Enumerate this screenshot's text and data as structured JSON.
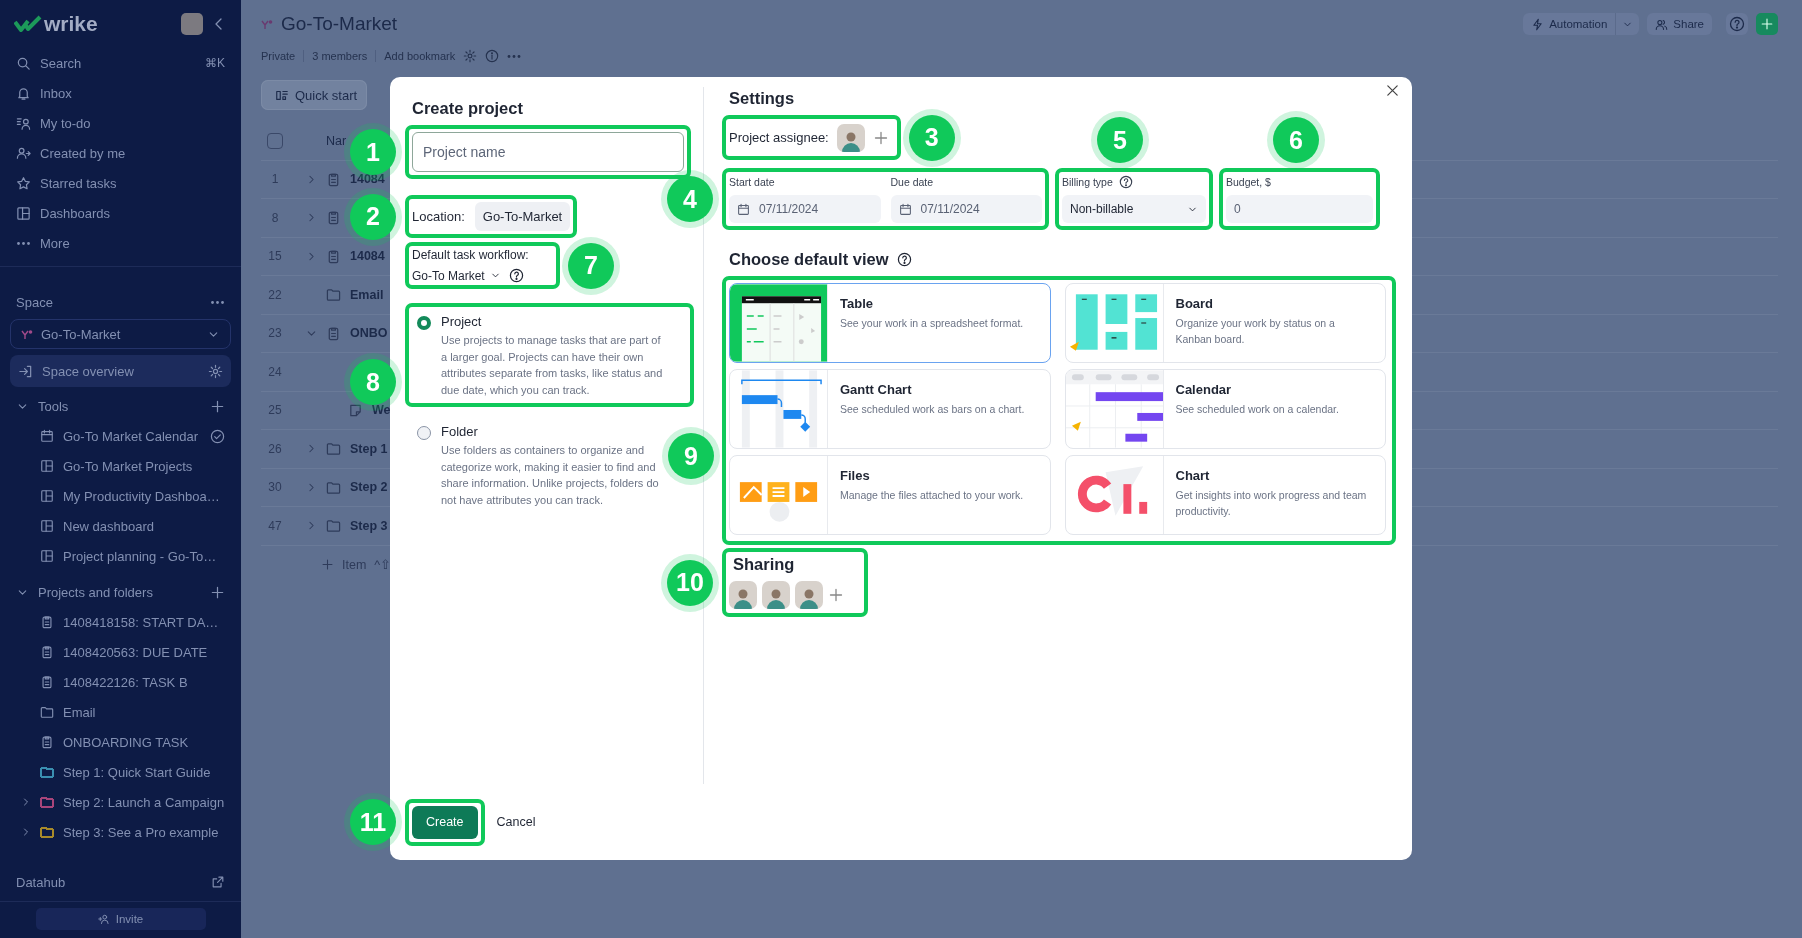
{
  "sidebar": {
    "logo": "wrike",
    "nav": [
      {
        "label": "Search",
        "shortcut": "⌘K",
        "selected": false
      },
      {
        "label": "Inbox",
        "selected": false
      },
      {
        "label": "My to-do",
        "selected": false
      },
      {
        "label": "Created by me",
        "selected": false
      },
      {
        "label": "Starred tasks",
        "selected": false
      },
      {
        "label": "Dashboards",
        "selected": false
      },
      {
        "label": "More",
        "selected": false
      }
    ],
    "space": {
      "heading": "Space",
      "name": "Go-To-Market"
    },
    "space_overview": {
      "label": "Space overview",
      "selected": true
    },
    "tools": {
      "heading": "Tools",
      "expanded": true,
      "items": [
        {
          "label": "Go-To Market Calendar",
          "kind": "calendar",
          "checked": true,
          "selected": false
        },
        {
          "label": "Go-To Market Projects",
          "kind": "dashboard",
          "checked": false,
          "selected": false
        },
        {
          "label": "My Productivity Dashboa…",
          "kind": "dashboard",
          "checked": false,
          "selected": false
        },
        {
          "label": "New dashboard",
          "kind": "dashboard",
          "checked": false,
          "selected": false
        },
        {
          "label": "Project planning - Go-To…",
          "kind": "dashboard",
          "checked": false,
          "selected": false
        }
      ]
    },
    "projects": {
      "heading": "Projects and folders",
      "expanded": true,
      "items": [
        {
          "label": "1408418158: START DA…",
          "kind": "project",
          "selected": false
        },
        {
          "label": "1408420563: DUE DATE",
          "kind": "project",
          "selected": false
        },
        {
          "label": "1408422126: TASK B",
          "kind": "project",
          "selected": false
        },
        {
          "label": "Email",
          "kind": "folder",
          "selected": false
        },
        {
          "label": "ONBOARDING TASK",
          "kind": "project",
          "selected": false
        },
        {
          "label": "Step 1: Quick Start Guide",
          "kind": "folder",
          "color": "#3a8fb0",
          "selected": false
        },
        {
          "label": "Step 2: Launch a Campaign",
          "kind": "folder",
          "color": "#a8457a",
          "expanded": false,
          "selected": false
        },
        {
          "label": "Step 3: See a Pro example",
          "kind": "folder",
          "color": "#a88a2a",
          "expanded": false,
          "selected": false
        }
      ]
    },
    "datahub": "Datahub",
    "invite": "Invite"
  },
  "header": {
    "title": "Go-To-Market",
    "meta": [
      "Private",
      "3 members",
      "Add bookmark"
    ],
    "automation": "Automation",
    "share": "Share"
  },
  "tabs": [
    {
      "label": "Quick start",
      "selected": true
    }
  ],
  "table": {
    "select_all": {
      "checked": false
    },
    "column_2": "Nar",
    "rows": [
      {
        "number": "1",
        "expanded": false,
        "kind": "project",
        "name": "14084"
      },
      {
        "number": "8",
        "expanded": false,
        "kind": "project"
      },
      {
        "number": "15",
        "expanded": false,
        "kind": "project",
        "name": "14084"
      },
      {
        "number": "22",
        "kind": "folder",
        "name": "Email"
      },
      {
        "number": "23",
        "expanded": true,
        "kind": "project",
        "name": "ONBO",
        "children": [
          {
            "number": "24"
          },
          {
            "number": "25",
            "kind": "note",
            "name": "We"
          }
        ]
      },
      {
        "number": "26",
        "expanded": false,
        "kind": "folder",
        "name": "Step 1"
      },
      {
        "number": "30",
        "expanded": false,
        "kind": "folder",
        "name": "Step 2"
      },
      {
        "number": "47",
        "expanded": false,
        "kind": "folder",
        "name": "Step 3"
      }
    ],
    "add_item": {
      "label": "Item",
      "shortcut": "^⇧"
    }
  },
  "dialog": {
    "title": "Create project",
    "name_field": {
      "placeholder": "Project name",
      "highlighted": true,
      "callout": "1"
    },
    "location": {
      "label": "Location:",
      "value": "Go-To-Market",
      "highlighted": true,
      "callout": "2"
    },
    "workflow": {
      "label": "Default task workflow:",
      "value": "Go-To Market",
      "highlighted": true,
      "callout": "7"
    },
    "types": [
      {
        "title": "Project",
        "description": "Use projects to manage tasks that are part of a larger goal. Projects can have their own attributes separate from tasks, like status and due date, which you can track.",
        "selected": true,
        "highlighted": true,
        "callout": "8"
      },
      {
        "title": "Folder",
        "description": "Use folders as containers to organize and categorize work, making it easier to find and share information. Unlike projects, folders do not have attributes you can track.",
        "selected": false,
        "highlighted": false
      }
    ],
    "settings": {
      "title": "Settings",
      "assignee": {
        "label": "Project assignee:",
        "highlighted": true,
        "callout": "3"
      },
      "dates": {
        "start_label": "Start date",
        "start": "07/11/2024",
        "due_label": "Due date",
        "due": "07/11/2024",
        "highlighted": true,
        "callout": "4"
      },
      "billing": {
        "label": "Billing type",
        "value": "Non-billable",
        "highlighted": true,
        "callout": "5"
      },
      "budget": {
        "label": "Budget, $",
        "value": "0",
        "highlighted": true,
        "callout": "6"
      }
    },
    "views": {
      "title": "Choose default view",
      "highlighted": true,
      "callout": "9",
      "items": [
        {
          "kind": "table",
          "title": "Table",
          "description": "See your work in a spreadsheet format.",
          "selected": true
        },
        {
          "kind": "board",
          "title": "Board",
          "description": "Organize your work by status on a Kanban board.",
          "selected": false
        },
        {
          "kind": "gantt",
          "title": "Gantt Chart",
          "description": "See scheduled work as bars on a chart.",
          "selected": false
        },
        {
          "kind": "calendar",
          "title": "Calendar",
          "description": "See scheduled work on a calendar.",
          "selected": false
        },
        {
          "kind": "files",
          "title": "Files",
          "description": "Manage the files attached to your work.",
          "selected": false
        },
        {
          "kind": "chart",
          "title": "Chart",
          "description": "Get insights into work progress and team productivity.",
          "selected": false
        }
      ]
    },
    "sharing": {
      "title": "Sharing",
      "avatars": [
        {
          "kind": "photo"
        },
        {
          "kind": "photo"
        },
        {
          "kind": "photo"
        }
      ],
      "highlighted": true,
      "callout": "10"
    },
    "footer": {
      "create": "Create",
      "cancel": "Cancel",
      "highlighted": true,
      "callout": "11"
    }
  }
}
